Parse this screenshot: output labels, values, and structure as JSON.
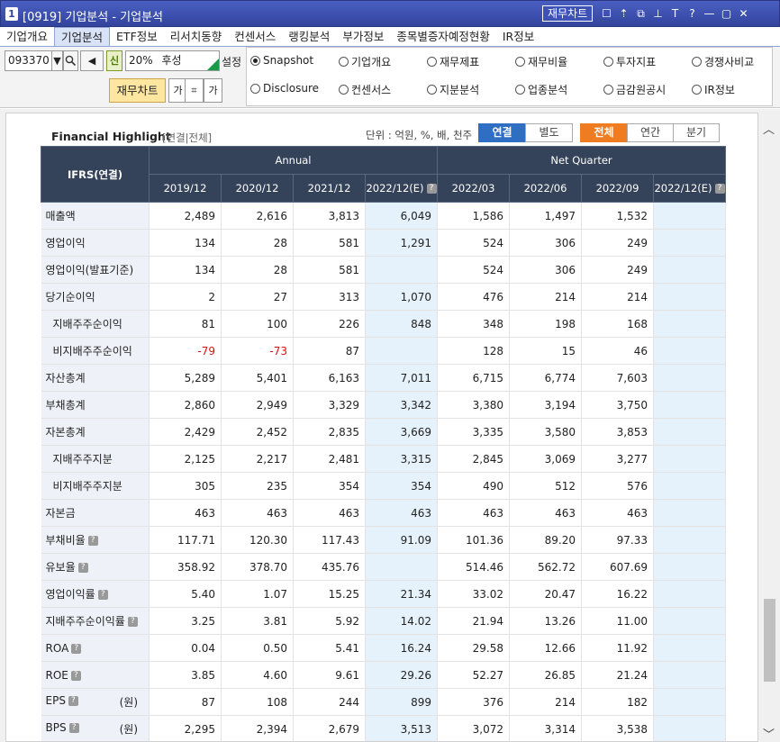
{
  "window": {
    "num": "1",
    "title": "[0919] 기업분석 - 기업분석",
    "chart_button": "재무차트",
    "icons": [
      "chat-icon",
      "upload-icon",
      "copy-icon",
      "pin-icon",
      "font-icon",
      "help-icon",
      "minimize-icon",
      "maximize-icon",
      "close-icon"
    ],
    "icon_glyphs": [
      "☐",
      "⇡",
      "⧉",
      "⊥",
      "T",
      "?",
      "—",
      "▢",
      "✕"
    ]
  },
  "menu": [
    "기업개요",
    "기업분석",
    "ETF정보",
    "리서치동향",
    "컨센서스",
    "랭킹분석",
    "부가정보",
    "종목별증자예정현황",
    "IR정보"
  ],
  "toolbar": {
    "code": "093370",
    "dropdown_glyph": "▼",
    "search_glyph": "🔍",
    "speaker_glyph": "◀",
    "new_glyph": "신",
    "percent": "20%",
    "name": "후성",
    "setting": "설정",
    "fin_chart": "재무차트",
    "icon_a": "가",
    "icon_b": "⌗",
    "icon_c": "가"
  },
  "radios": [
    {
      "label": "Snapshot",
      "checked": true
    },
    {
      "label": "기업개요",
      "checked": false
    },
    {
      "label": "재무제표",
      "checked": false
    },
    {
      "label": "재무비율",
      "checked": false
    },
    {
      "label": "투자지표",
      "checked": false
    },
    {
      "label": "경쟁사비교",
      "checked": false
    },
    {
      "label": "Disclosure",
      "checked": false
    },
    {
      "label": "컨센서스",
      "checked": false
    },
    {
      "label": "지분분석",
      "checked": false
    },
    {
      "label": "업종분석",
      "checked": false
    },
    {
      "label": "금감원공시",
      "checked": false
    },
    {
      "label": "IR정보",
      "checked": false
    }
  ],
  "highlight": {
    "title": "Financial Highlight",
    "subtitle": "[연결|전체]",
    "unit": "단위 : 억원, %, 배, 천주",
    "tabs1": [
      "연결",
      "별도"
    ],
    "tabs2": [
      "전체",
      "연간",
      "분기"
    ]
  },
  "table": {
    "corner": "IFRS(연결)",
    "group_annual": "Annual",
    "group_quarter": "Net Quarter",
    "columns": [
      "2019/12",
      "2020/12",
      "2021/12",
      "2022/12(E)",
      "2022/03",
      "2022/06",
      "2022/09",
      "2022/12(E)"
    ],
    "estimate_cols": [
      3,
      7
    ],
    "rows": [
      {
        "label": "매출액",
        "sub": false,
        "q": false,
        "unit": "",
        "values": [
          "2,489",
          "2,616",
          "3,813",
          "6,049",
          "1,586",
          "1,497",
          "1,532",
          ""
        ]
      },
      {
        "label": "영업이익",
        "sub": false,
        "q": false,
        "unit": "",
        "values": [
          "134",
          "28",
          "581",
          "1,291",
          "524",
          "306",
          "249",
          ""
        ]
      },
      {
        "label": "영업이익(발표기준)",
        "sub": false,
        "q": false,
        "unit": "",
        "values": [
          "134",
          "28",
          "581",
          "",
          "524",
          "306",
          "249",
          ""
        ]
      },
      {
        "label": "당기순이익",
        "sub": false,
        "q": false,
        "unit": "",
        "values": [
          "2",
          "27",
          "313",
          "1,070",
          "476",
          "214",
          "214",
          ""
        ]
      },
      {
        "label": "지배주주순이익",
        "sub": true,
        "q": false,
        "unit": "",
        "values": [
          "81",
          "100",
          "226",
          "848",
          "348",
          "198",
          "168",
          ""
        ]
      },
      {
        "label": "비지배주주순이익",
        "sub": true,
        "q": false,
        "unit": "",
        "values": [
          "-79",
          "-73",
          "87",
          "",
          "128",
          "15",
          "46",
          ""
        ]
      },
      {
        "label": "자산총계",
        "sub": false,
        "q": false,
        "unit": "",
        "values": [
          "5,289",
          "5,401",
          "6,163",
          "7,011",
          "6,715",
          "6,774",
          "7,603",
          ""
        ]
      },
      {
        "label": "부채총계",
        "sub": false,
        "q": false,
        "unit": "",
        "values": [
          "2,860",
          "2,949",
          "3,329",
          "3,342",
          "3,380",
          "3,194",
          "3,750",
          ""
        ]
      },
      {
        "label": "자본총계",
        "sub": false,
        "q": false,
        "unit": "",
        "values": [
          "2,429",
          "2,452",
          "2,835",
          "3,669",
          "3,335",
          "3,580",
          "3,853",
          ""
        ]
      },
      {
        "label": "지배주주지분",
        "sub": true,
        "q": false,
        "unit": "",
        "values": [
          "2,125",
          "2,217",
          "2,481",
          "3,315",
          "2,845",
          "3,069",
          "3,277",
          ""
        ]
      },
      {
        "label": "비지배주주지분",
        "sub": true,
        "q": false,
        "unit": "",
        "values": [
          "305",
          "235",
          "354",
          "354",
          "490",
          "512",
          "576",
          ""
        ]
      },
      {
        "label": "자본금",
        "sub": false,
        "q": false,
        "unit": "",
        "values": [
          "463",
          "463",
          "463",
          "463",
          "463",
          "463",
          "463",
          ""
        ]
      },
      {
        "label": "부채비율",
        "sub": false,
        "q": true,
        "unit": "",
        "values": [
          "117.71",
          "120.30",
          "117.43",
          "91.09",
          "101.36",
          "89.20",
          "97.33",
          ""
        ]
      },
      {
        "label": "유보율",
        "sub": false,
        "q": true,
        "unit": "",
        "values": [
          "358.92",
          "378.70",
          "435.76",
          "",
          "514.46",
          "562.72",
          "607.69",
          ""
        ]
      },
      {
        "label": "영업이익률",
        "sub": false,
        "q": true,
        "unit": "",
        "values": [
          "5.40",
          "1.07",
          "15.25",
          "21.34",
          "33.02",
          "20.47",
          "16.22",
          ""
        ]
      },
      {
        "label": "지배주주순이익률",
        "sub": false,
        "q": true,
        "unit": "",
        "values": [
          "3.25",
          "3.81",
          "5.92",
          "14.02",
          "21.94",
          "13.26",
          "11.00",
          ""
        ]
      },
      {
        "label": "ROA",
        "sub": false,
        "q": true,
        "unit": "",
        "values": [
          "0.04",
          "0.50",
          "5.41",
          "16.24",
          "29.58",
          "12.66",
          "11.92",
          ""
        ]
      },
      {
        "label": "ROE",
        "sub": false,
        "q": true,
        "unit": "",
        "values": [
          "3.85",
          "4.60",
          "9.61",
          "29.26",
          "52.27",
          "26.85",
          "21.24",
          ""
        ]
      },
      {
        "label": "EPS",
        "sub": false,
        "q": true,
        "unit": "(원)",
        "values": [
          "87",
          "108",
          "244",
          "899",
          "376",
          "214",
          "182",
          ""
        ]
      },
      {
        "label": "BPS",
        "sub": false,
        "q": true,
        "unit": "(원)",
        "values": [
          "2,295",
          "2,394",
          "2,679",
          "3,513",
          "3,072",
          "3,314",
          "3,538",
          ""
        ]
      }
    ]
  },
  "scroll": {
    "up": "︿",
    "down": "﹀"
  }
}
